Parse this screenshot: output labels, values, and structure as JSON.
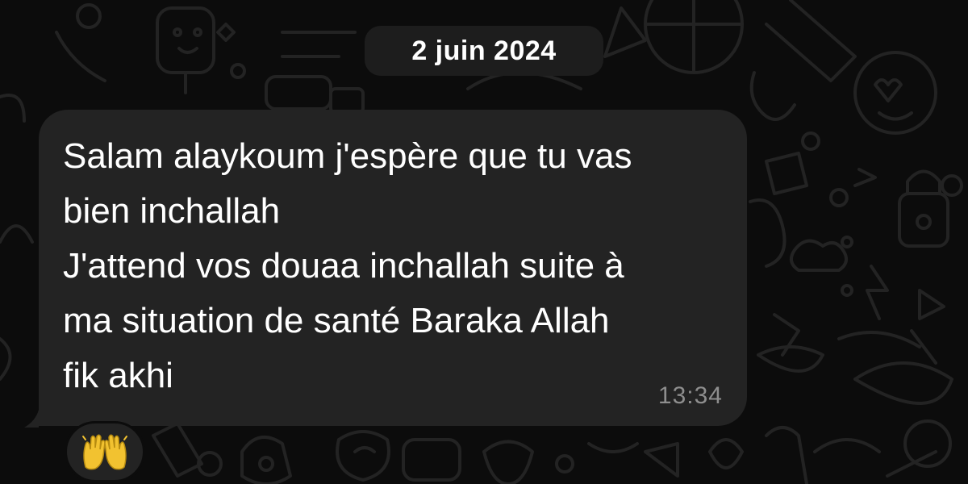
{
  "chat": {
    "date_separator": "2 juin 2024",
    "message": {
      "text": "Salam alaykoum j'espère que tu vas\nbien inchallah\nJ'attend vos douaa inchallah suite à\nma situation de santé Baraka Allah\nfik akhi",
      "time": "13:34",
      "reaction": "raising-hands-emoji"
    }
  },
  "colors": {
    "background": "#0c0c0c",
    "bubble": "#232323",
    "date_pill": "#1d1d1d",
    "text": "#ffffff",
    "timestamp": "#8e8e8e",
    "reaction_hands": "#f2c230"
  }
}
